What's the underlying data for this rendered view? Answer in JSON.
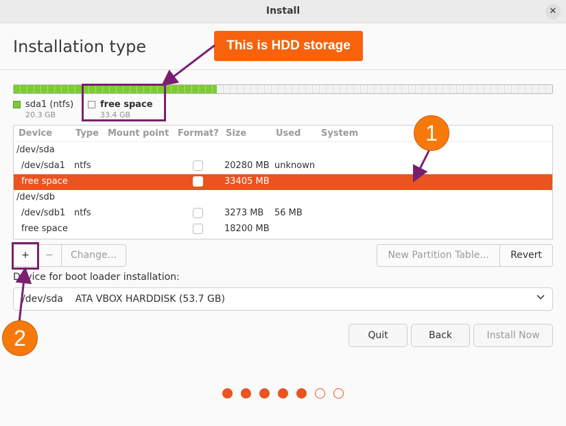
{
  "window": {
    "title": "Install",
    "close_glyph": "✕"
  },
  "page": {
    "title": "Installation type"
  },
  "disk": {
    "used_fraction": 0.377,
    "used_color": "#7ccb35",
    "legend": [
      {
        "name": "sda1 (ntfs)",
        "size": "20.3 GB",
        "color": "#7ccb35"
      },
      {
        "name": "free space",
        "size": "33.4 GB",
        "color": "#ffffff"
      }
    ]
  },
  "table": {
    "headers": [
      "Device",
      "Type",
      "Mount point",
      "Format?",
      "Size",
      "Used",
      "System"
    ],
    "rows": [
      {
        "device": "/dev/sda",
        "type": "",
        "size": "",
        "used": "",
        "checkbox": false,
        "selected": false
      },
      {
        "device": "/dev/sda1",
        "type": "ntfs",
        "size": "20280 MB",
        "used": "unknown",
        "checkbox": true,
        "selected": false
      },
      {
        "device": "free space",
        "type": "",
        "size": "33405 MB",
        "used": "",
        "checkbox": true,
        "selected": true
      },
      {
        "device": "/dev/sdb",
        "type": "",
        "size": "",
        "used": "",
        "checkbox": false,
        "selected": false
      },
      {
        "device": "/dev/sdb1",
        "type": "ntfs",
        "size": "3273 MB",
        "used": "56 MB",
        "checkbox": true,
        "selected": false
      },
      {
        "device": "free space",
        "type": "",
        "size": "18200 MB",
        "used": "",
        "checkbox": true,
        "selected": false
      }
    ]
  },
  "toolbar": {
    "add_label": "+",
    "remove_label": "−",
    "change_label": "Change...",
    "new_table_label": "New Partition Table...",
    "revert_label": "Revert"
  },
  "boot": {
    "label": "Device for boot loader installation:",
    "value": "/dev/sda    ATA VBOX HARDDISK (53.7 GB)"
  },
  "nav": {
    "quit_label": "Quit",
    "back_label": "Back",
    "install_label": "Install Now"
  },
  "progress": {
    "total_steps": 7,
    "completed_steps": 5,
    "accent": "#e95420"
  },
  "annotations": {
    "callout_text": "This is HDD storage",
    "badge_1": "1",
    "badge_2": "2",
    "callout_color": "#f7630c",
    "highlight_color": "#7a1f6f"
  }
}
